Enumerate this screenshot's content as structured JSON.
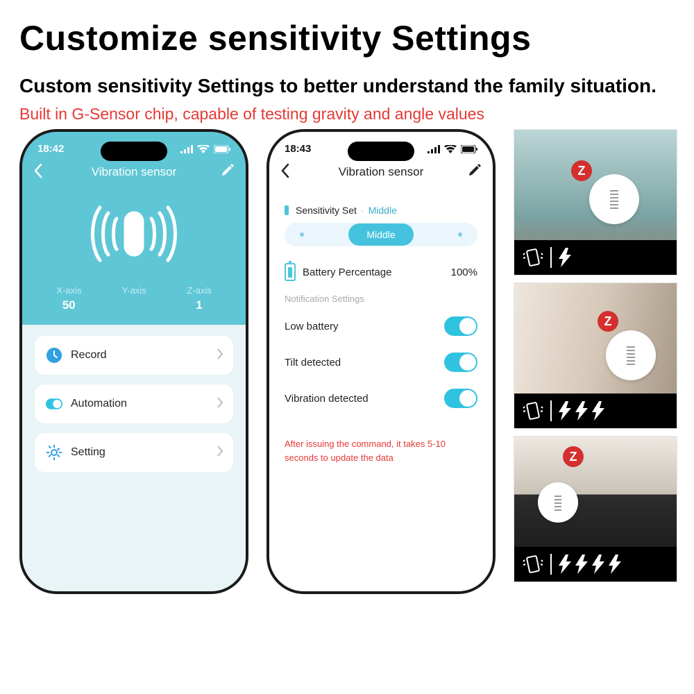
{
  "heading": "Customize sensitivity Settings",
  "subheading": "Custom sensitivity Settings to better understand the family situation.",
  "redline": "Built in G-Sensor chip, capable of testing gravity and angle values",
  "phone1": {
    "time": "18:42",
    "title": "Vibration sensor",
    "axes": [
      {
        "label": "X-axis",
        "value": "50"
      },
      {
        "label": "Y-axis",
        "value": ""
      },
      {
        "label": "Z-axis",
        "value": "1"
      }
    ],
    "menu": {
      "record": "Record",
      "automation": "Automation",
      "setting": "Setting"
    }
  },
  "phone2": {
    "time": "18:43",
    "title": "Vibration sensor",
    "sens_label": "Sensitivity Set",
    "sens_value": "Middle",
    "pill": "Middle",
    "batt_label": "Battery Percentage",
    "batt_value": "100%",
    "section": "Notification Settings",
    "toggles": {
      "low_battery": "Low battery",
      "tilt": "Tilt detected",
      "vibration": "Vibration detected"
    },
    "note": "After issuing the command, it takes 5-10 seconds to update the data"
  },
  "tiles": {
    "bolt_counts": [
      1,
      3,
      4
    ]
  }
}
